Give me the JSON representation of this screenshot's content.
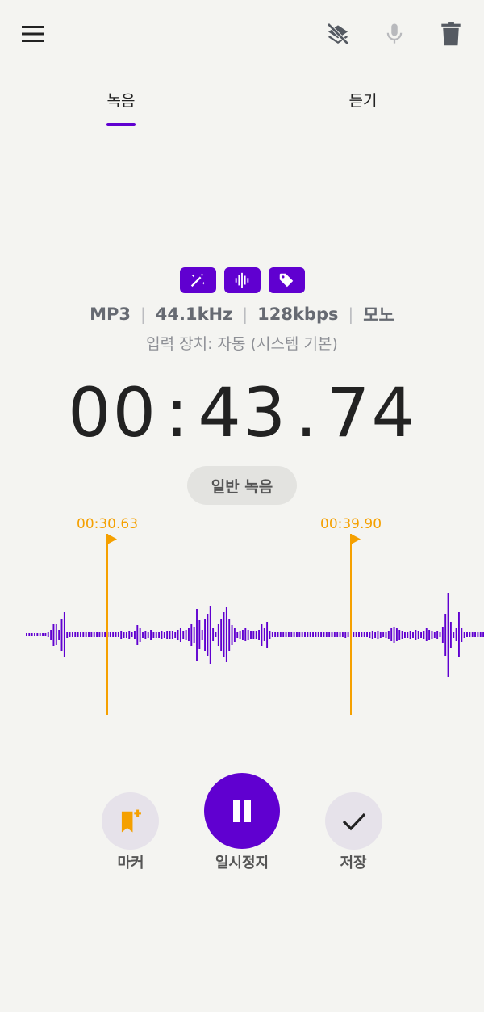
{
  "header": {
    "icons": [
      "menu-icon",
      "layers-off-icon",
      "microphone-icon",
      "trash-icon"
    ]
  },
  "tabs": [
    {
      "label": "녹음",
      "active": true
    },
    {
      "label": "듣기",
      "active": false
    }
  ],
  "badges": [
    "magic-wand-icon",
    "waveform-icon",
    "tag-icon"
  ],
  "format": {
    "codec": "MP3",
    "sample_rate": "44.1kHz",
    "bitrate": "128kbps",
    "channels": "모노",
    "separator": "|"
  },
  "input_device": "입력 장치: 자동 (시스템 기본)",
  "timer": {
    "minutes": "00",
    "seconds": "43",
    "hundredths": "74",
    "colon": ":",
    "dot": "."
  },
  "mode": "일반 녹음",
  "markers": [
    {
      "time": "00:30.63"
    },
    {
      "time": "00:39.90"
    }
  ],
  "controls": {
    "marker_label": "마커",
    "pause_label": "일시정지",
    "save_label": "저장"
  },
  "colors": {
    "accent": "#6000d0",
    "marker": "#f5a000",
    "background": "#f4f4f1"
  }
}
